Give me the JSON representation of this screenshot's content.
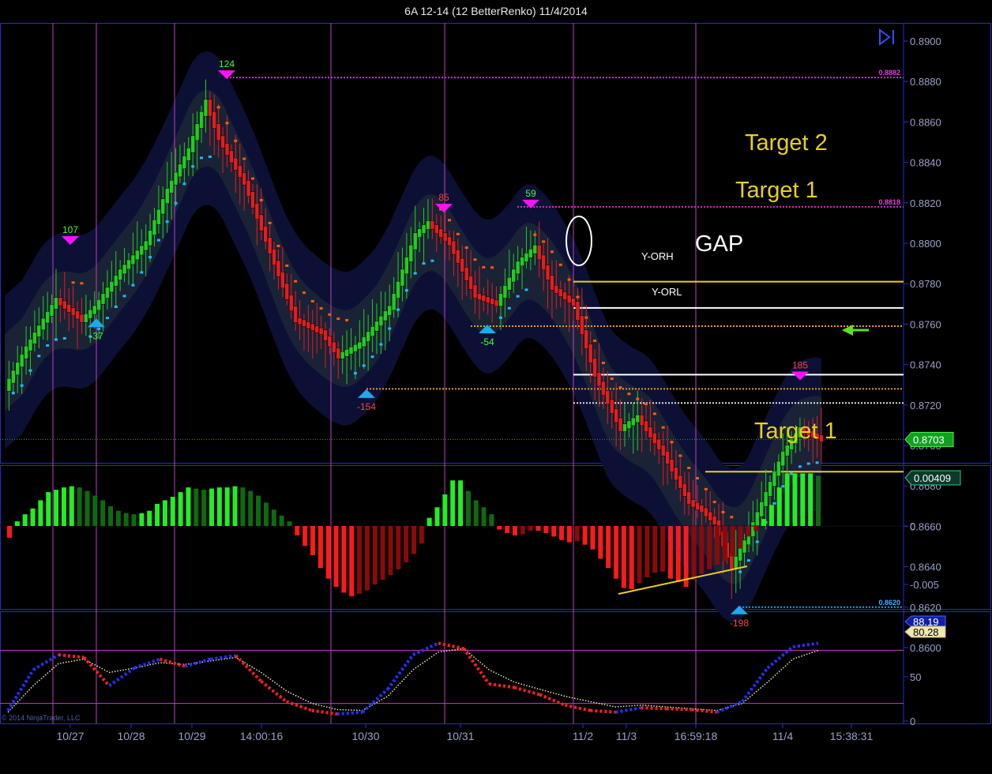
{
  "window": {
    "title": "6A 12-14 (12 BetterRenko)  11/4/2014"
  },
  "colors": {
    "background": "#000000",
    "grid_border": "#2a2ad0",
    "session_line": "#c040c0",
    "bull_candle": "#22cc22",
    "bear_candle": "#dd2020",
    "band": "#141a30",
    "up_trend_dots": "#22b8ff",
    "down_trend_dots": "#ff5a10",
    "target_line": "#e8d020",
    "gap_line": "#ffffff",
    "macd_up": "#22ee22",
    "macd_up_weak": "#0f6a0f",
    "macd_down": "#ff1a1a",
    "macd_down_weak": "#8a0a0a",
    "stoch_k": "#2233ff",
    "stoch_d": "#f0e8b0",
    "stoch_red": "#ff2020"
  },
  "chart_data": [
    {
      "type": "candlestick",
      "panel": "price",
      "bar_type": "12 BetterRenko",
      "ylim": [
        0.859,
        0.8905
      ],
      "y_ticks": [
        "0.8900",
        "0.8880",
        "0.8860",
        "0.8840",
        "0.8820",
        "0.8800",
        "0.8780",
        "0.8760",
        "0.8740",
        "0.8720",
        "0.8700",
        "0.8680",
        "0.8660",
        "0.8640",
        "0.8620",
        "0.8600"
      ],
      "last_price_label": "0.8703",
      "last_price": 0.8703,
      "x_labels": [
        "10/27",
        "10/28",
        "10/29",
        "14:00:16",
        "10/30",
        "10/31",
        "11/2",
        "11/3",
        "16:59:18",
        "11/4",
        "15:38:31"
      ],
      "levels": [
        {
          "name": "high-level",
          "value": 0.8882,
          "label": "0.8882",
          "style": "magenta-dotted"
        },
        {
          "name": "target2-level",
          "value": 0.8818,
          "label": "0.8818",
          "style": "magenta-dotted"
        },
        {
          "name": "low-level",
          "value": 0.862,
          "label": "0.8620",
          "style": "cyan-dotted"
        },
        {
          "name": "target1-upper",
          "value": 0.8781,
          "style": "yellow-solid"
        },
        {
          "name": "gap-top",
          "value": 0.8768,
          "style": "white-solid"
        },
        {
          "name": "orange-upper",
          "value": 0.8759,
          "style": "orange-dotted"
        },
        {
          "name": "y-orh",
          "value": 0.8735,
          "style": "white-solid"
        },
        {
          "name": "orange-lower",
          "value": 0.8728,
          "style": "orange-dotted"
        },
        {
          "name": "y-orl",
          "value": 0.8721,
          "style": "white-dotted"
        },
        {
          "name": "yellow-lower",
          "value": 0.8687,
          "style": "yellow-solid"
        }
      ],
      "swing_labels": [
        {
          "text": "107",
          "value": 0.88,
          "kind": "high"
        },
        {
          "text": "-37",
          "value": 0.8762,
          "kind": "low"
        },
        {
          "text": "124",
          "value": 0.8882,
          "kind": "high"
        },
        {
          "text": "-154",
          "value": 0.8727,
          "kind": "low"
        },
        {
          "text": "85",
          "value": 0.8816,
          "kind": "high"
        },
        {
          "text": "-54",
          "value": 0.8759,
          "kind": "low"
        },
        {
          "text": "59",
          "value": 0.8818,
          "kind": "high"
        },
        {
          "text": "185",
          "value": 0.8733,
          "kind": "high"
        },
        {
          "text": "-198",
          "value": 0.862,
          "kind": "low"
        }
      ],
      "annotations": {
        "target2": "Target 2",
        "target1_top": "Target 1",
        "gap": "GAP",
        "y_orh": "Y-ORH",
        "y_orl": "Y-ORL",
        "target1_bottom": "Target 1"
      },
      "copyright": "© 2014 NinjaTrader, LLC",
      "close_path": [
        [
          0.8728,
          0
        ],
        [
          0.8748,
          5
        ],
        [
          0.8772,
          12
        ],
        [
          0.8762,
          18
        ],
        [
          0.8768,
          21
        ],
        [
          0.8786,
          27
        ],
        [
          0.88,
          33
        ],
        [
          0.8826,
          38
        ],
        [
          0.8846,
          43
        ],
        [
          0.887,
          47
        ],
        [
          0.8852,
          50
        ],
        [
          0.883,
          56
        ],
        [
          0.8796,
          62
        ],
        [
          0.8762,
          68
        ],
        [
          0.8756,
          74
        ],
        [
          0.8744,
          78
        ],
        [
          0.875,
          83
        ],
        [
          0.8768,
          90
        ],
        [
          0.8804,
          96
        ],
        [
          0.881,
          99
        ],
        [
          0.88,
          104
        ],
        [
          0.8774,
          110
        ],
        [
          0.877,
          115
        ],
        [
          0.879,
          120
        ],
        [
          0.8798,
          124
        ],
        [
          0.8778,
          128
        ],
        [
          0.877,
          133
        ],
        [
          0.8735,
          138
        ],
        [
          0.8708,
          144
        ],
        [
          0.8714,
          148
        ],
        [
          0.8696,
          154
        ],
        [
          0.8672,
          160
        ],
        [
          0.8668,
          163
        ],
        [
          0.8662,
          166
        ],
        [
          0.864,
          170
        ],
        [
          0.8656,
          174
        ],
        [
          0.8676,
          178
        ],
        [
          0.8696,
          182
        ],
        [
          0.8708,
          186
        ],
        [
          0.8703,
          191
        ]
      ]
    },
    {
      "type": "bar",
      "panel": "macd-histogram",
      "ylim": [
        -0.0063,
        0.0045
      ],
      "y_ticks": [
        "0",
        "-0.005"
      ],
      "last_value_label": "0.00409",
      "trendline": "yellow divergence line",
      "values": [
        -0.001,
        0.0004,
        0.001,
        0.0015,
        0.0022,
        0.0029,
        0.0031,
        0.0033,
        0.0034,
        0.0033,
        0.003,
        0.0026,
        0.0022,
        0.0017,
        0.0013,
        0.0011,
        0.001,
        0.0011,
        0.0013,
        0.0019,
        0.0022,
        0.0025,
        0.0029,
        0.0033,
        0.0032,
        0.0031,
        0.0032,
        0.0033,
        0.0033,
        0.0034,
        0.0033,
        0.003,
        0.0026,
        0.002,
        0.0014,
        0.0009,
        0.0004,
        -0.0008,
        -0.0017,
        -0.0025,
        -0.0036,
        -0.0045,
        -0.0052,
        -0.0057,
        -0.006,
        -0.0058,
        -0.0055,
        -0.005,
        -0.0046,
        -0.0042,
        -0.0037,
        -0.0031,
        -0.0024,
        -0.0015,
        0.0007,
        0.0016,
        0.0027,
        0.0039,
        0.0039,
        0.003,
        0.0022,
        0.0016,
        0.001,
        -0.0003,
        -0.0006,
        -0.0008,
        -0.0007,
        -0.0004,
        -0.0004,
        -0.0006,
        -0.0009,
        -0.0012,
        -0.0014,
        -0.0013,
        -0.0016,
        -0.002,
        -0.0028,
        -0.0036,
        -0.0045,
        -0.0053,
        -0.0054,
        -0.0049,
        -0.0044,
        -0.004,
        -0.0039,
        -0.0045,
        -0.0048,
        -0.0052,
        -0.0046,
        -0.0041,
        -0.0037,
        -0.0033,
        -0.003,
        -0.0026,
        -0.0019,
        -0.0009,
        -0.0004,
        0.0006,
        0.0018,
        0.0033,
        0.0045,
        0.0045,
        0.0045,
        0.0045,
        0.0043
      ]
    },
    {
      "type": "line",
      "panel": "stochastics",
      "ylim": [
        0,
        100
      ],
      "y_ticks": [
        "50",
        "0"
      ],
      "k_label": "88.19",
      "d_label": "80.28",
      "series": [
        {
          "key": "k",
          "values": [
            12,
            58,
            75,
            72,
            40,
            60,
            70,
            62,
            70,
            74,
            45,
            22,
            12,
            8,
            10,
            36,
            75,
            88,
            82,
            42,
            38,
            30,
            18,
            12,
            10,
            15,
            14,
            13,
            10,
            22,
            60,
            84,
            88
          ]
        },
        {
          "key": "d",
          "values": [
            10,
            40,
            65,
            70,
            55,
            60,
            66,
            64,
            68,
            72,
            55,
            34,
            20,
            13,
            12,
            28,
            58,
            78,
            82,
            58,
            44,
            36,
            28,
            22,
            16,
            18,
            16,
            14,
            12,
            20,
            44,
            70,
            80
          ]
        }
      ]
    }
  ]
}
